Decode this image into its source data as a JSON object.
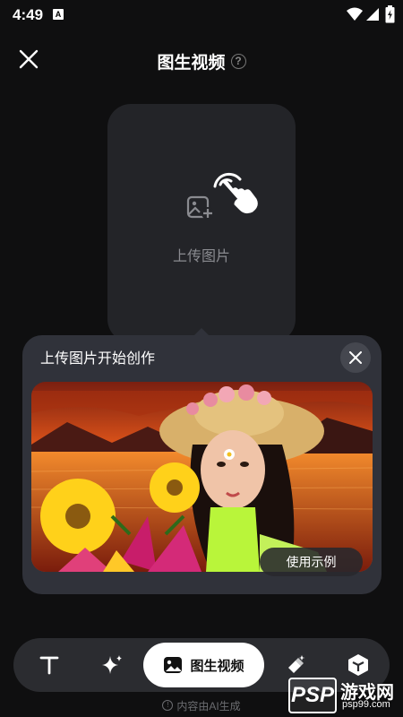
{
  "status": {
    "time": "4:49",
    "notif_badge": "A"
  },
  "header": {
    "title": "图生视频",
    "help_icon": "?"
  },
  "upload": {
    "label": "上传图片"
  },
  "tip": {
    "title": "上传图片开始创作",
    "example_button": "使用示例"
  },
  "toolbar": {
    "items": [
      {
        "icon": "text-icon",
        "label": ""
      },
      {
        "icon": "sparkle-icon",
        "label": ""
      },
      {
        "icon": "image-icon",
        "label": "图生视频"
      },
      {
        "icon": "magic-wand-icon",
        "label": ""
      },
      {
        "icon": "cube-icon",
        "label": ""
      }
    ]
  },
  "footer": {
    "ai_note": "内容由AI生成",
    "info_icon": "!"
  },
  "watermark": {
    "logo_text": "PSP",
    "name": "游戏网",
    "url": "psp99.com"
  },
  "colors": {
    "background": "#0f0f10",
    "card": "#232428",
    "panel": "#30323a",
    "toolbar": "#2b2c30",
    "active_tab": "#ffffff"
  }
}
